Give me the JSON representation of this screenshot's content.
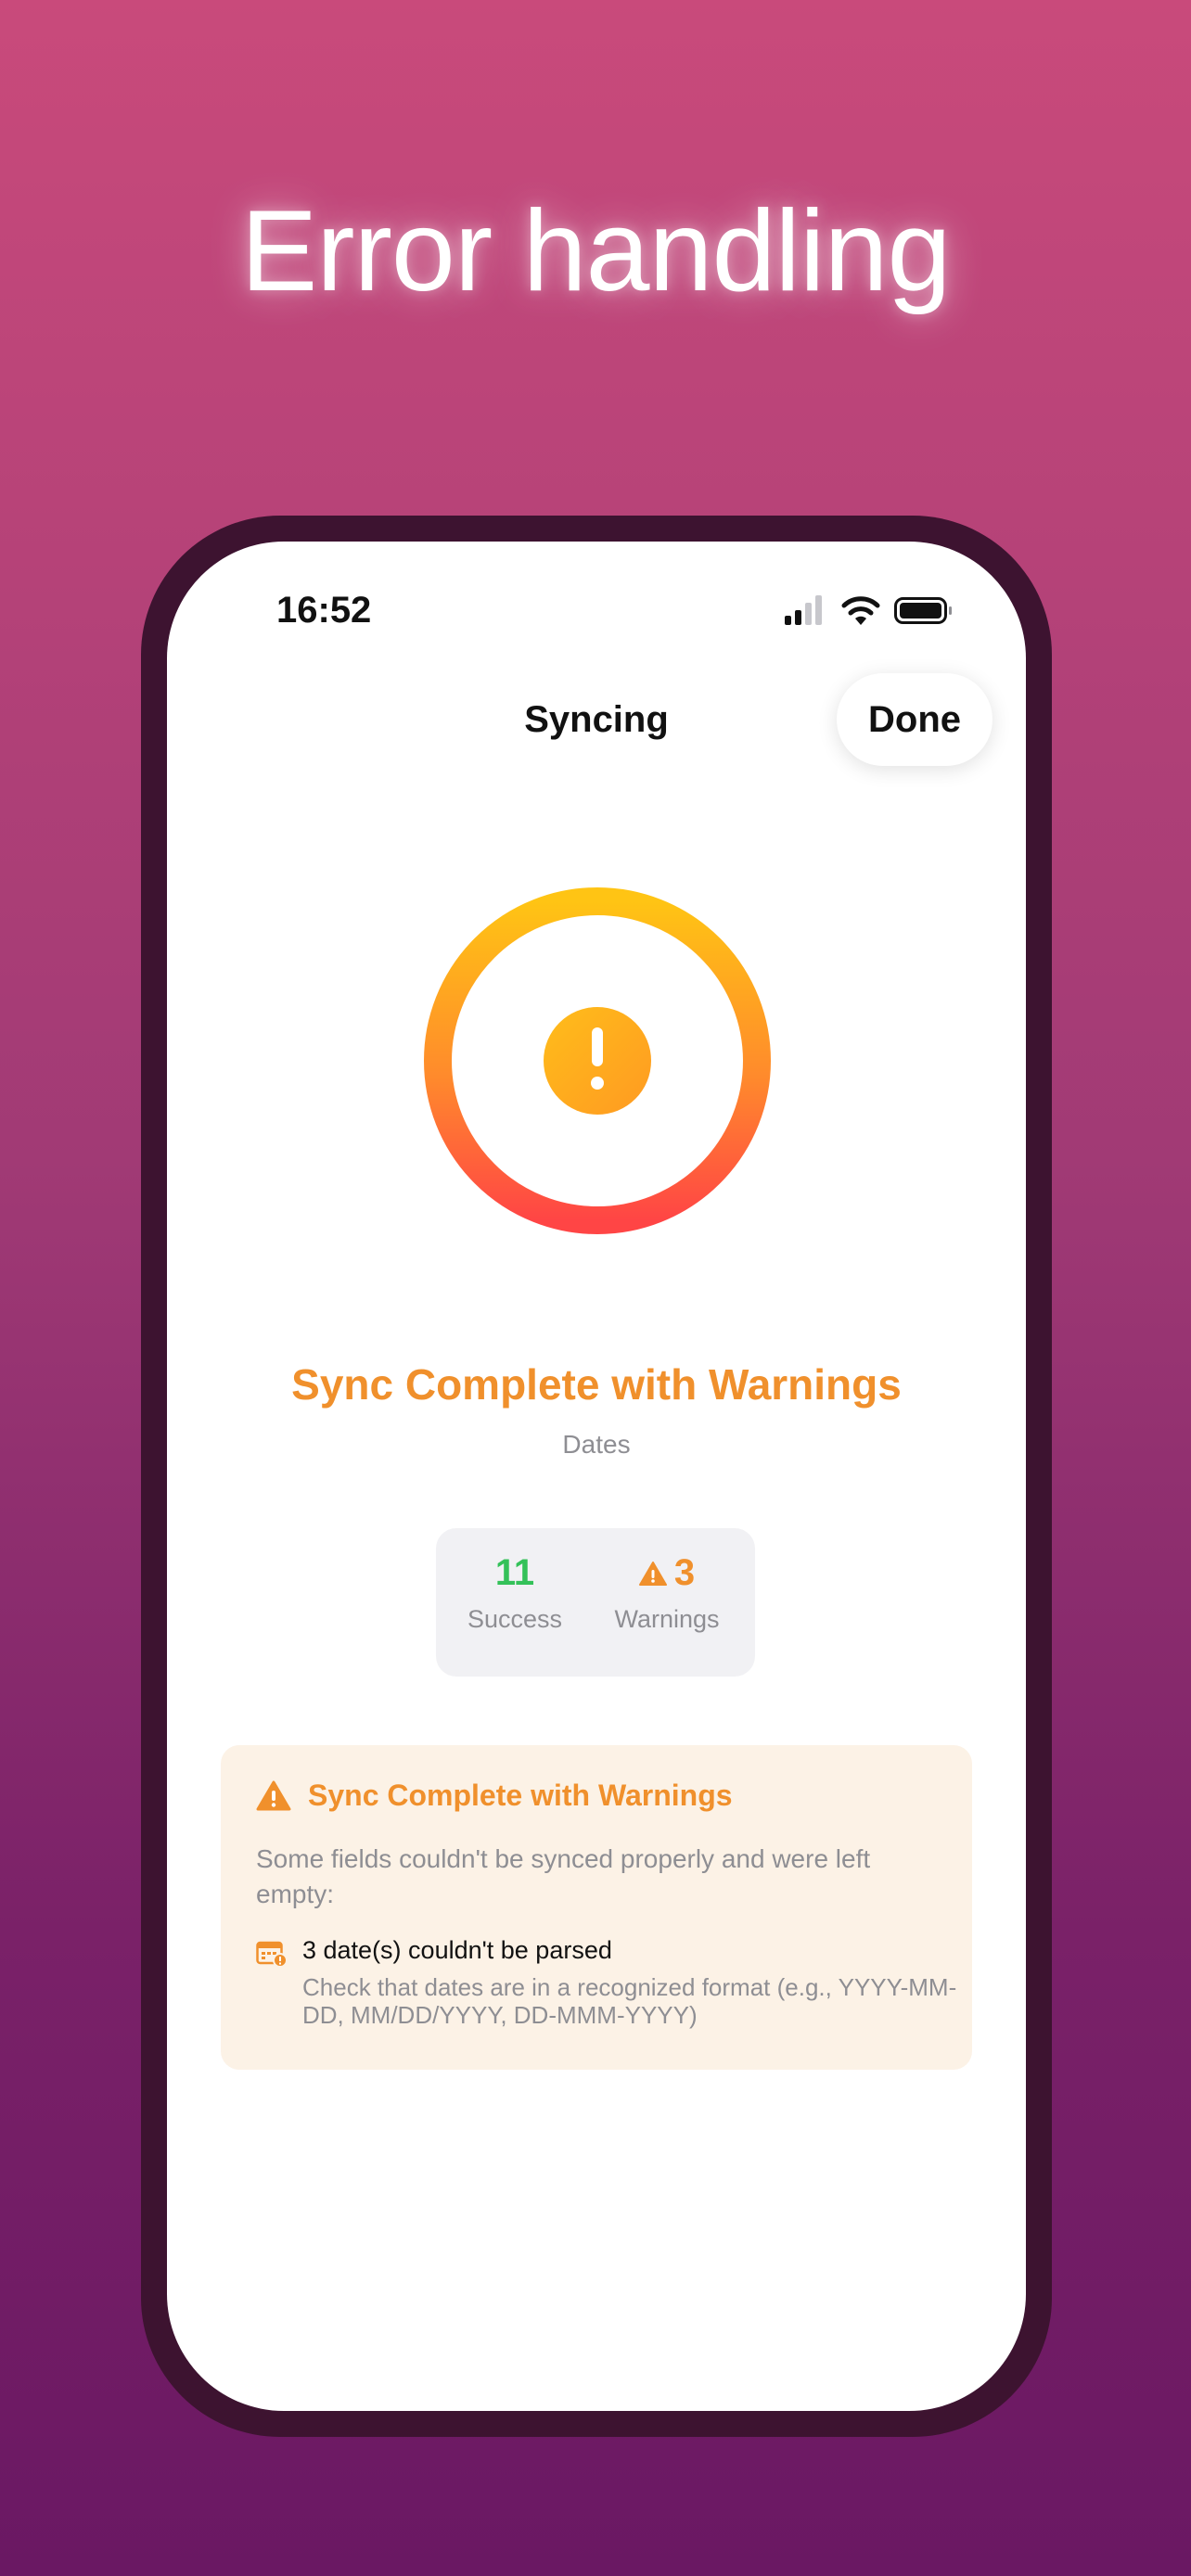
{
  "headline": "Error handling",
  "status_bar": {
    "time": "16:52",
    "icons": [
      "signal-icon",
      "wifi-icon",
      "battery-icon"
    ]
  },
  "nav": {
    "title": "Syncing",
    "done_label": "Done"
  },
  "progress": {
    "icon": "exclamation-icon",
    "fraction": 1.0
  },
  "status": {
    "title": "Sync Complete with Warnings",
    "subtitle": "Dates"
  },
  "stats": {
    "success": {
      "value": "11",
      "label": "Success"
    },
    "warnings": {
      "value": "3",
      "label": "Warnings",
      "icon": "warning-icon"
    }
  },
  "warning_card": {
    "title": "Sync Complete with Warnings",
    "body": "Some fields couldn't be synced properly and were left empty:",
    "items": [
      {
        "icon": "calendar-warning-icon",
        "title": "3 date(s) couldn't be parsed",
        "description": "Check that dates are in a recognized format (e.g., YYYY-MM-DD, MM/DD/YYYY, DD-MMM-YYYY)"
      }
    ]
  },
  "colors": {
    "accent_orange": "#f0902c",
    "success_green": "#34c159",
    "ring_start": "#ffc414",
    "ring_end": "#ff4545",
    "warning_bg": "#fcf2e6"
  }
}
